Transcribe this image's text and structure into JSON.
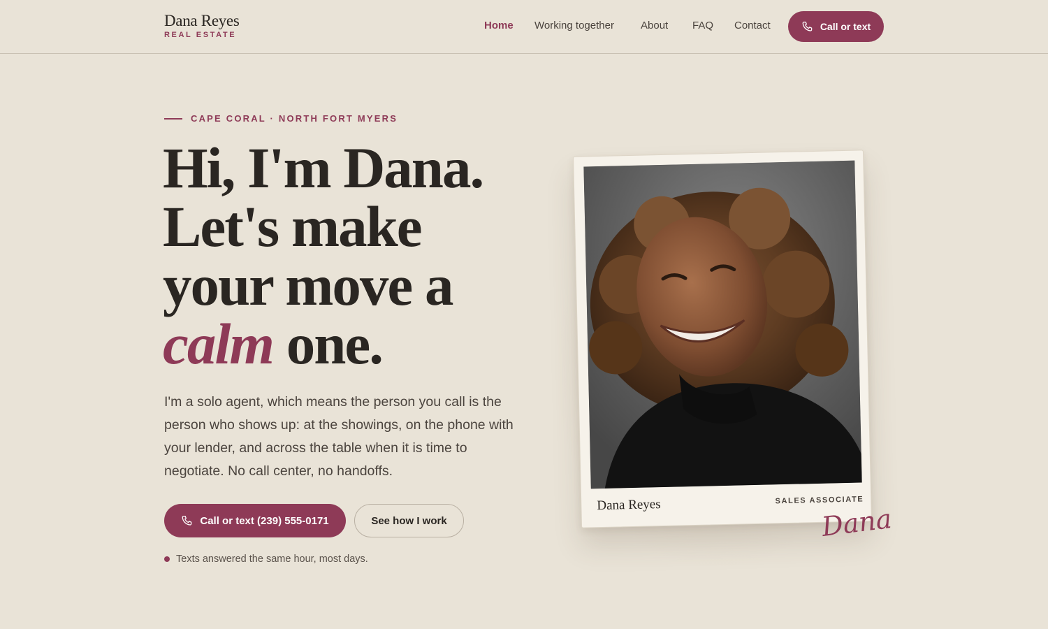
{
  "brand": {
    "name": "Dana Reyes",
    "tagline": "REAL ESTATE"
  },
  "nav": {
    "items": [
      {
        "label": "Home",
        "active": true
      },
      {
        "label": "Working together",
        "active": false
      },
      {
        "label": "About",
        "active": false
      },
      {
        "label": "FAQ",
        "active": false
      },
      {
        "label": "Contact",
        "active": false
      }
    ],
    "cta_label": "Call or text"
  },
  "hero": {
    "eyebrow": "CAPE CORAL · NORTH FORT MYERS",
    "headline": {
      "line1": "Hi, I'm Dana.",
      "line2": "Let's make",
      "line3": "your move a",
      "accent": "calm",
      "line4_rest": "one."
    },
    "intro": "I'm a solo agent, which means the person you call is the person who shows up: at the showings, on the phone with your lender, and across the table when it is time to negotiate. No call center, no handoffs.",
    "primary_button": "Call or text (239) 555-0171",
    "secondary_button": "See how I work",
    "note": "Texts answered the same hour, most days."
  },
  "photo_card": {
    "name": "Dana Reyes",
    "role": "SALES ASSOCIATE",
    "signature": "Dana",
    "image_description": "portrait-photo"
  },
  "colors": {
    "background": "#e9e3d7",
    "accent": "#8e3a57",
    "text": "#2a2622",
    "card": "#f6f2ea"
  },
  "icons": {
    "phone": "phone-icon"
  }
}
